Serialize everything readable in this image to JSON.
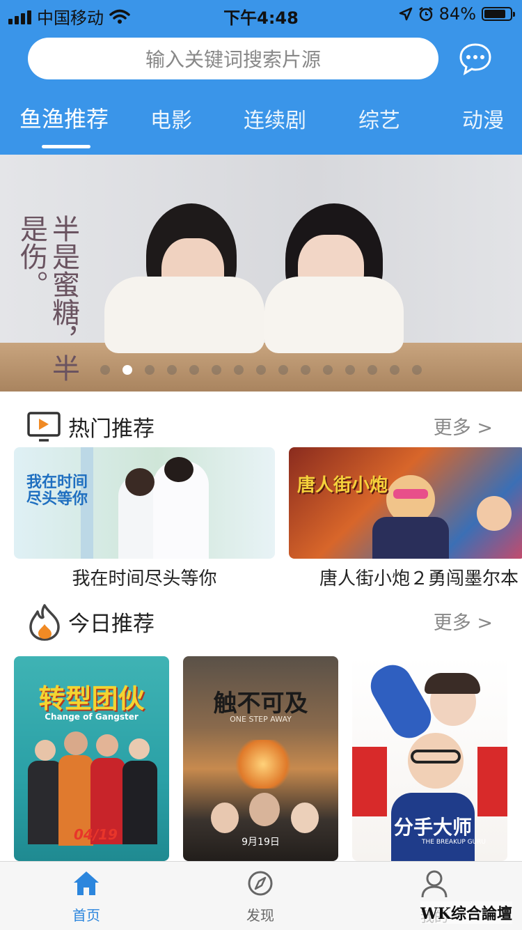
{
  "status_bar": {
    "carrier": "中国移动",
    "time": "下午4:48",
    "battery": "84%",
    "battery_level": 0.84
  },
  "search": {
    "placeholder": "输入关键词搜索片源"
  },
  "tabs": [
    {
      "label": "鱼渔推荐",
      "active": true
    },
    {
      "label": "电影"
    },
    {
      "label": "连续剧"
    },
    {
      "label": "综艺"
    },
    {
      "label": "动漫"
    }
  ],
  "banner": {
    "poster_text": "半是蜜糖，半是伤。",
    "page_count": 15,
    "active_index": 1
  },
  "hot": {
    "title": "热门推荐",
    "more": "更多 >",
    "items": [
      {
        "title": "我在时间尽头等你",
        "poster_text": "我在时间尽头等你"
      },
      {
        "title": "唐人街小炮２勇闯墨尔本",
        "poster_text": "唐人街小炮"
      }
    ]
  },
  "today": {
    "title": "今日推荐",
    "more": "更多 >",
    "items": [
      {
        "poster_text": "转型团伙",
        "poster_sub": "Change of Gangster",
        "date": "04/19"
      },
      {
        "poster_text": "触不可及",
        "poster_sub": "ONE STEP AWAY",
        "date": "9月19日"
      },
      {
        "poster_text": "分手大师",
        "poster_sub": "THE BREAKUP GURU"
      }
    ]
  },
  "tabbar": {
    "items": [
      {
        "label": "首页",
        "icon": "home-icon",
        "active": true
      },
      {
        "label": "发现",
        "icon": "compass-icon"
      },
      {
        "label": "我的",
        "icon": "user-icon"
      }
    ]
  },
  "watermark": "WK综合論壇",
  "colors": {
    "primary": "#3a95e9",
    "tab_active": "#2c86dd"
  }
}
